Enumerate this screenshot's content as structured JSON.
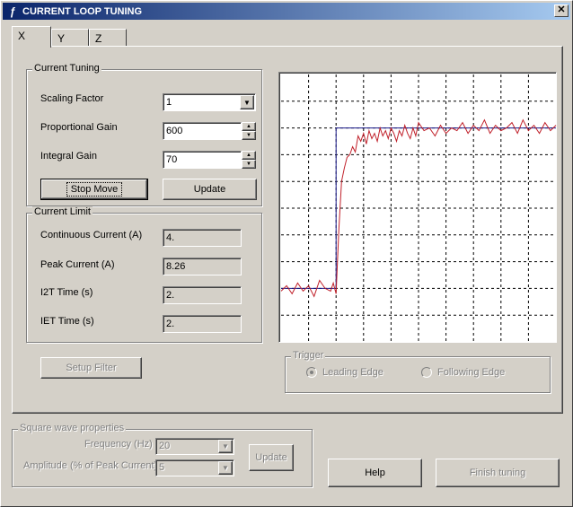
{
  "window": {
    "title": "CURRENT LOOP TUNING",
    "close_glyph": "✕"
  },
  "tabs": [
    {
      "label": "X",
      "active": true
    },
    {
      "label": "Y"
    },
    {
      "label": "Z"
    }
  ],
  "current_tuning": {
    "group_label": "Current Tuning",
    "scaling_factor": {
      "label": "Scaling Factor",
      "value": "1"
    },
    "proportional_gain": {
      "label": "Proportional Gain",
      "value": "600"
    },
    "integral_gain": {
      "label": "Integral Gain",
      "value": "70"
    },
    "stop_move_label": "Stop Move",
    "update_label": "Update"
  },
  "current_limit": {
    "group_label": "Current Limit",
    "continuous_current": {
      "label": "Continuous Current (A)",
      "value": "4."
    },
    "peak_current": {
      "label": "Peak Current (A)",
      "value": "8.26"
    },
    "i2t_time": {
      "label": "I2T Time (s)",
      "value": "2."
    },
    "iet_time": {
      "label": "IET Time (s)",
      "value": "2."
    }
  },
  "setup_filter_label": "Setup Filter",
  "trigger": {
    "group_label": "Trigger",
    "leading_edge": "Leading Edge",
    "following_edge": "Following Edge",
    "selected": "Leading Edge"
  },
  "square_wave": {
    "group_label": "Square wave properties",
    "frequency": {
      "label": "Frequency (Hz)",
      "value": "20"
    },
    "amplitude": {
      "label": "Amplitude (% of Peak Current)",
      "value": "5"
    },
    "update_label": "Update"
  },
  "help_label": "Help",
  "finish_tuning_label": "Finish tuning",
  "colors": {
    "title_gradient_start": "#0a246a",
    "title_gradient_end": "#a6caf0",
    "command_line": "#1a1a8a",
    "response_line": "#c0202a"
  },
  "chart_data": {
    "type": "line",
    "grid": true,
    "grid_divisions": {
      "x": 10,
      "y": 10
    },
    "ylim": [
      0,
      10
    ],
    "xlim": [
      0,
      100
    ],
    "series": [
      {
        "values_x": [
          0,
          20,
          20,
          100
        ],
        "values_y": [
          2,
          2,
          8,
          8
        ],
        "color": "#1a1a8a"
      },
      {
        "values_x": [
          0,
          2,
          4,
          6,
          8,
          10,
          12,
          14,
          16,
          18,
          19,
          20,
          21,
          22,
          23,
          24,
          25,
          26,
          27,
          28,
          29,
          30,
          31,
          32,
          33,
          34,
          35,
          36,
          37,
          38,
          39,
          40,
          41,
          42,
          43,
          44,
          45,
          46,
          47,
          48,
          49,
          50,
          52,
          54,
          56,
          58,
          60,
          62,
          64,
          66,
          68,
          70,
          72,
          74,
          76,
          78,
          80,
          82,
          84,
          86,
          88,
          90,
          92,
          94,
          96,
          98,
          100
        ],
        "values_y": [
          1.9,
          2.1,
          1.8,
          2.2,
          1.9,
          2.1,
          1.7,
          2.3,
          2.0,
          1.9,
          2.2,
          1.8,
          4.2,
          6.0,
          6.5,
          6.9,
          7.0,
          7.3,
          7.1,
          7.7,
          7.5,
          7.8,
          7.4,
          7.9,
          7.6,
          7.8,
          7.5,
          8.0,
          7.7,
          7.9,
          7.6,
          8.0,
          7.8,
          7.5,
          7.9,
          7.7,
          8.1,
          7.8,
          7.6,
          8.0,
          7.7,
          8.2,
          7.9,
          8.0,
          7.7,
          8.1,
          7.8,
          8.0,
          7.9,
          8.2,
          7.8,
          8.1,
          7.9,
          8.3,
          7.8,
          8.1,
          7.9,
          8.0,
          8.2,
          7.8,
          8.3,
          7.9,
          8.1,
          7.8,
          8.2,
          7.9,
          8.1
        ],
        "color": "#c0202a"
      }
    ]
  }
}
